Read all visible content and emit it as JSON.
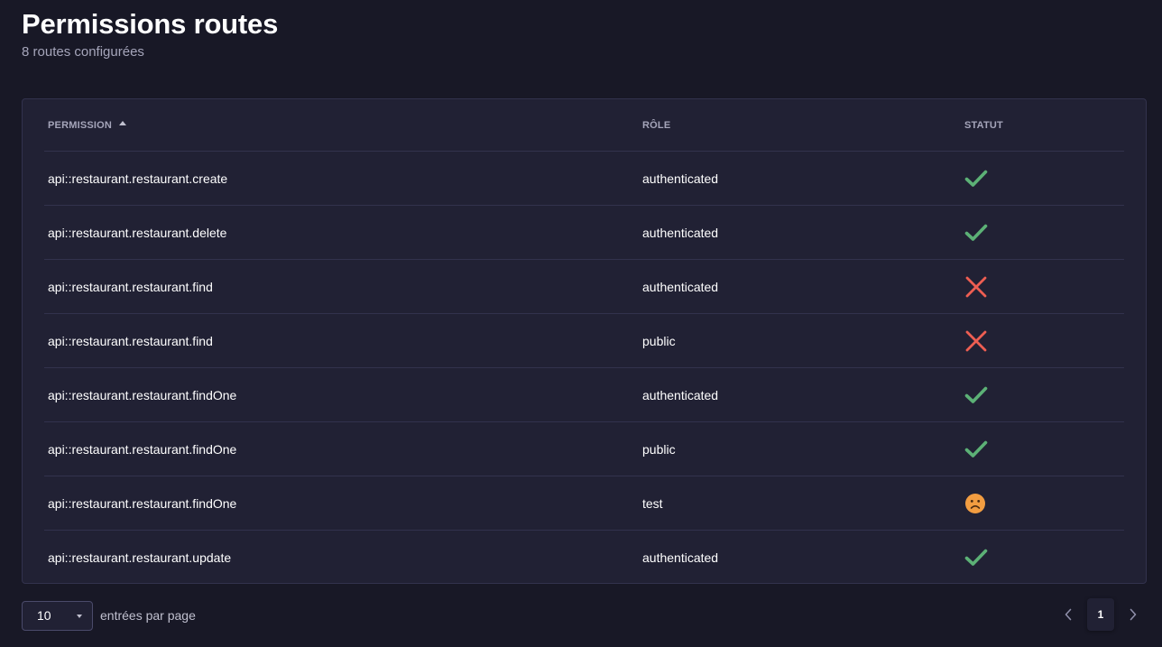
{
  "header": {
    "title": "Permissions routes",
    "subtitle": "8 routes configurées"
  },
  "table": {
    "columns": {
      "permission": "PERMISSION",
      "role": "RÔLE",
      "status": "STATUT"
    },
    "sort": {
      "column": "permission",
      "direction": "ascending"
    },
    "rows": [
      {
        "permission": "api::restaurant.restaurant.create",
        "role": "authenticated",
        "status": "check-icon"
      },
      {
        "permission": "api::restaurant.restaurant.delete",
        "role": "authenticated",
        "status": "check-icon"
      },
      {
        "permission": "api::restaurant.restaurant.find",
        "role": "authenticated",
        "status": "cross-icon"
      },
      {
        "permission": "api::restaurant.restaurant.find",
        "role": "public",
        "status": "cross-icon"
      },
      {
        "permission": "api::restaurant.restaurant.findOne",
        "role": "authenticated",
        "status": "check-icon"
      },
      {
        "permission": "api::restaurant.restaurant.findOne",
        "role": "public",
        "status": "check-icon"
      },
      {
        "permission": "api::restaurant.restaurant.findOne",
        "role": "test",
        "status": "frown-icon"
      },
      {
        "permission": "api::restaurant.restaurant.update",
        "role": "authenticated",
        "status": "check-icon"
      }
    ]
  },
  "footer": {
    "page_size": "10",
    "per_page_label": "entrées par page",
    "current_page": "1"
  },
  "colors": {
    "background": "#181826",
    "card": "#212134",
    "border": "#32324d",
    "check": "#5cb176",
    "cross": "#ee5e52",
    "frown": "#f29d41"
  }
}
